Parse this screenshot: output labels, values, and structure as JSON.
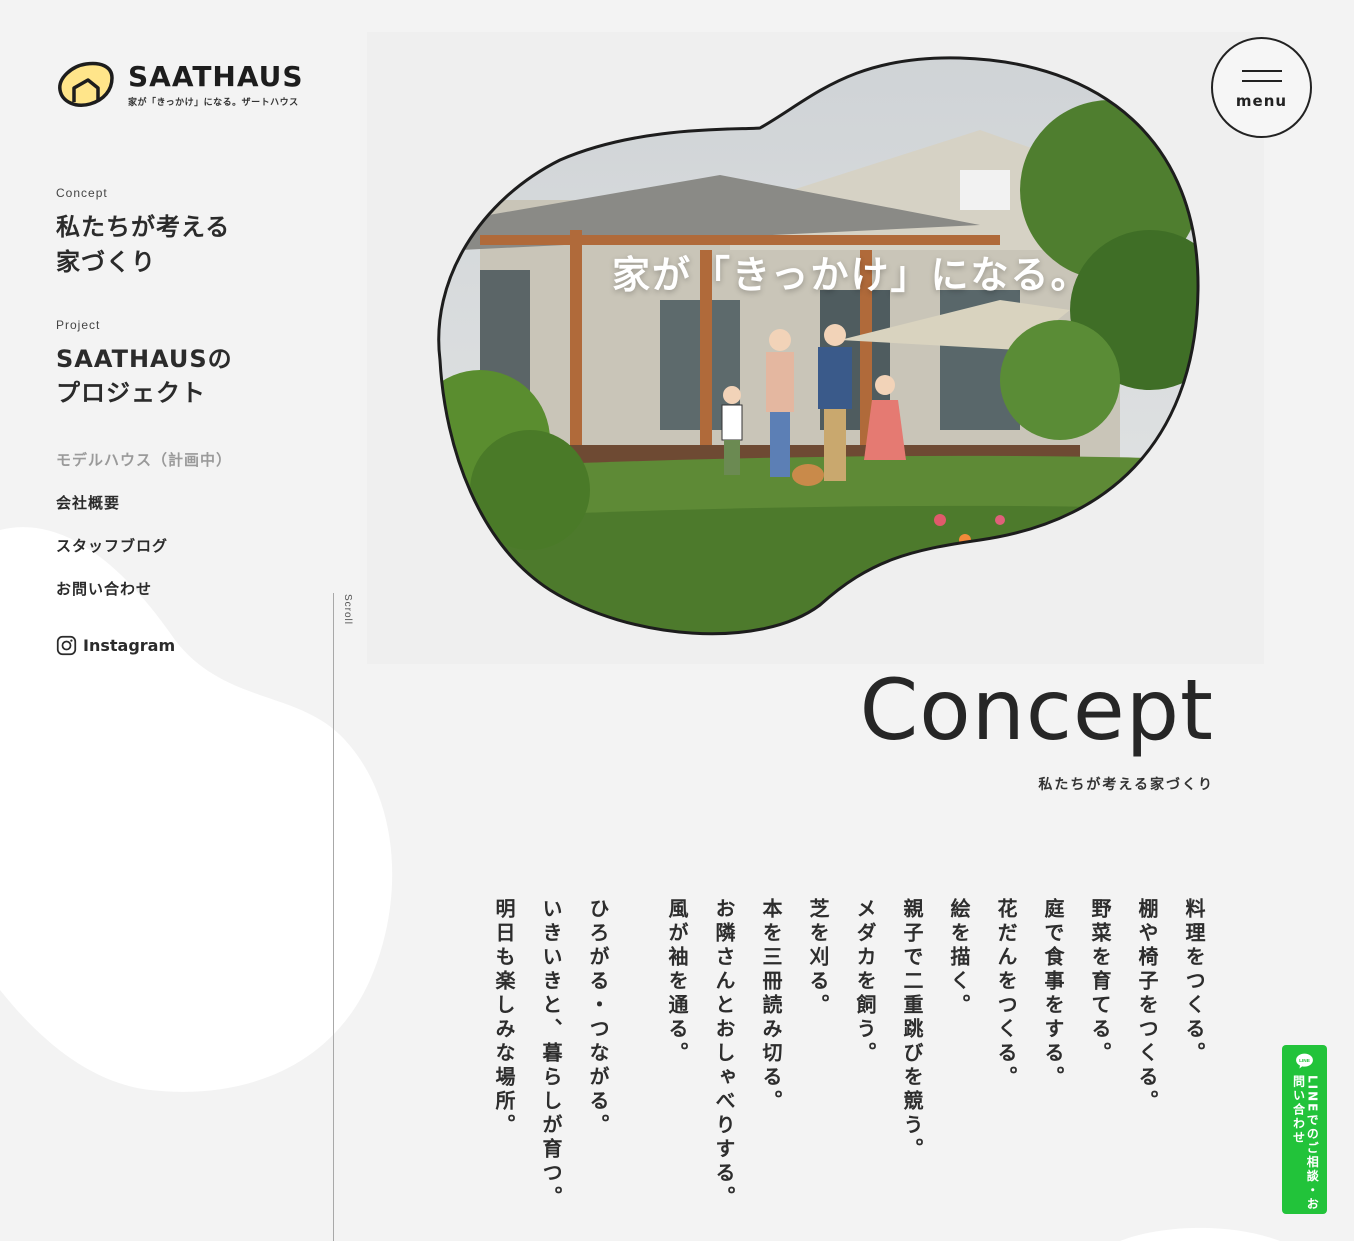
{
  "brand": {
    "name": "SAATHAUS",
    "tagline": "家が「きっかけ」になる。ザートハウス",
    "accent": "#ffe58a"
  },
  "nav": {
    "concept": {
      "small": "Concept",
      "big_line1": "私たちが考える",
      "big_line2": "家づくり"
    },
    "project": {
      "small": "Project",
      "big_line1": "SAATHAUSの",
      "big_line2": "プロジェクト"
    },
    "items": [
      {
        "label": "モデルハウス（計画中）",
        "muted": true
      },
      {
        "label": "会社概要"
      },
      {
        "label": "スタッフブログ"
      },
      {
        "label": "お問い合わせ"
      }
    ],
    "instagram": "Instagram"
  },
  "scroll_label": "Scroll",
  "hero": {
    "title": "家が「きっかけ」になる。"
  },
  "menu": {
    "label": "menu"
  },
  "concept": {
    "title": "Concept",
    "subtitle": "私たちが考える家づくり",
    "lines": [
      "料理をつくる。",
      "棚や椅子をつくる。",
      "野菜を育てる。",
      "庭で食事をする。",
      "花だんをつくる。",
      "絵を描く。",
      "親子で二重跳びを競う。",
      "メダカを飼う。",
      "芝を刈る。",
      "本を三冊読み切る。",
      "お隣さんとおしゃべりする。",
      "風が袖を通る。",
      "ひろがる・つながる。",
      "いきいきと、暮らしが育つ。",
      "明日も楽しみな場所。"
    ]
  },
  "line_button": {
    "icon_text": "LINE",
    "text": "LINEでのご相談・お問い合わせ",
    "color": "#22c33a"
  }
}
